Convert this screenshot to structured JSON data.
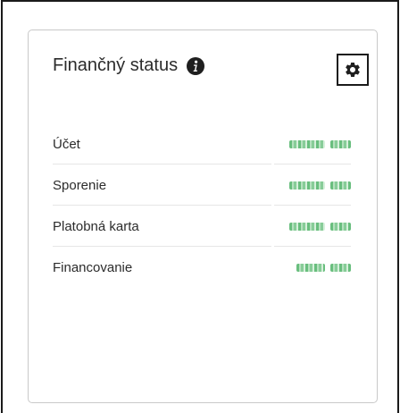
{
  "card": {
    "title": "Finančný status",
    "info_icon": "info-circle-icon",
    "settings_icon": "gear-icon"
  },
  "rows": [
    {
      "label": "Účet"
    },
    {
      "label": "Sporenie"
    },
    {
      "label": "Platobná karta"
    },
    {
      "label": "Financovanie"
    }
  ],
  "colors": {
    "text": "#2b2b2b",
    "card_border": "#c9c9c9",
    "divider": "#e6e6e6",
    "blurred_value": "#61ba77"
  }
}
